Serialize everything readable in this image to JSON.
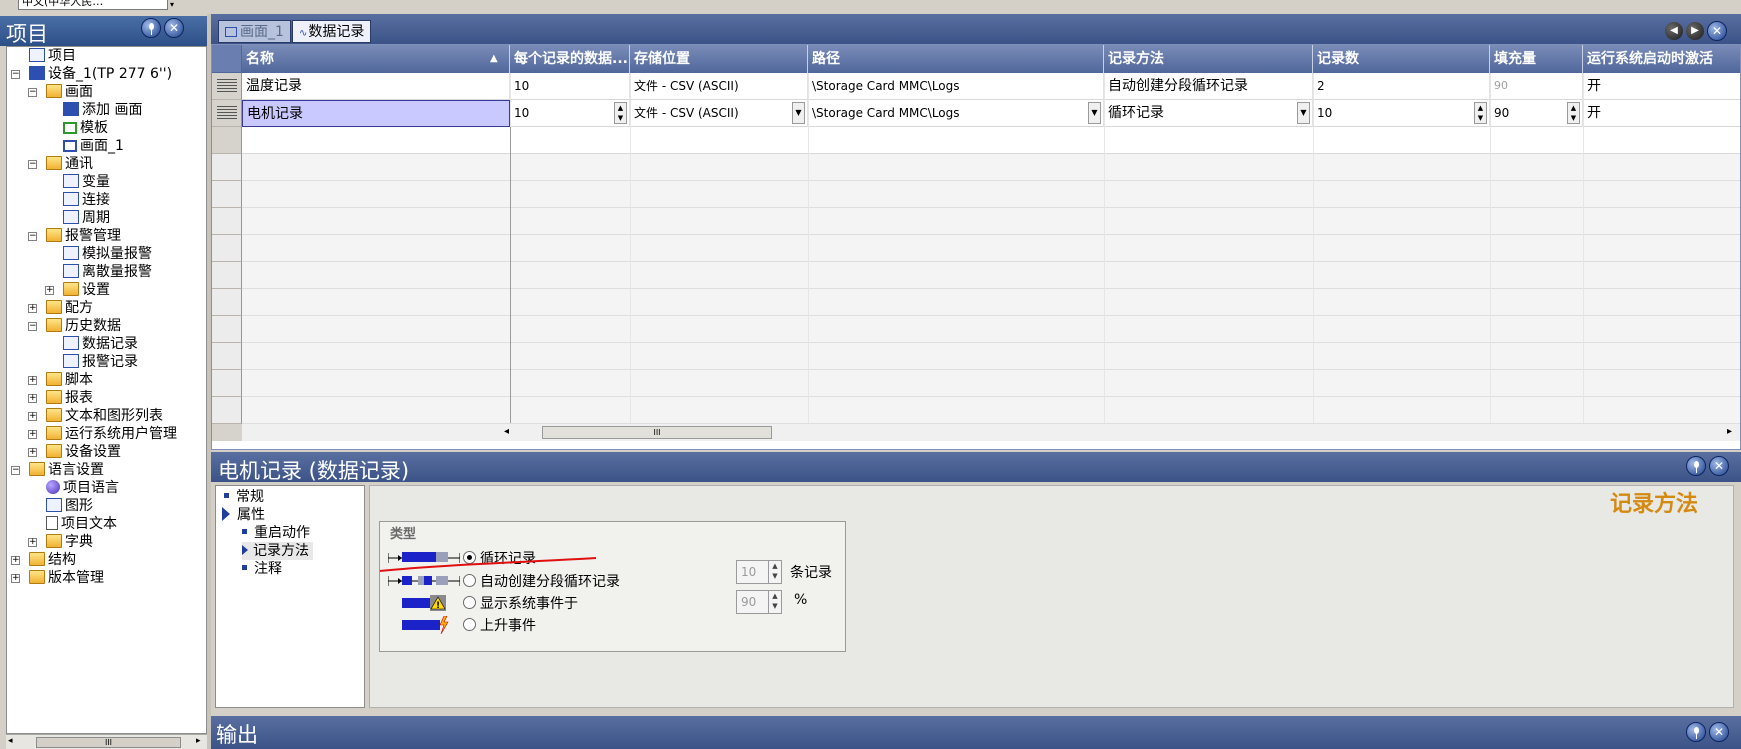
{
  "top": {
    "language_value": "中文(中华人民…",
    "dropdown_glyph": "▾"
  },
  "project": {
    "title": "项目",
    "tree": [
      {
        "label": "项目",
        "level": 0,
        "icon": "project-icon",
        "expander": ""
      },
      {
        "label": "设备_1(TP 277 6'')",
        "level": 0,
        "icon": "device-icon",
        "expander": "−"
      },
      {
        "label": "画面",
        "level": 1,
        "icon": "folder-icon",
        "expander": "−"
      },
      {
        "label": "添加 画面",
        "level": 2,
        "icon": "add-screen-icon",
        "expander": ""
      },
      {
        "label": "模板",
        "level": 2,
        "icon": "template-icon",
        "expander": ""
      },
      {
        "label": "画面_1",
        "level": 2,
        "icon": "screen-icon",
        "expander": ""
      },
      {
        "label": "通讯",
        "level": 1,
        "icon": "folder-icon",
        "expander": "−"
      },
      {
        "label": "变量",
        "level": 2,
        "icon": "tag-icon",
        "expander": ""
      },
      {
        "label": "连接",
        "level": 2,
        "icon": "connection-icon",
        "expander": ""
      },
      {
        "label": "周期",
        "level": 2,
        "icon": "cycle-icon",
        "expander": ""
      },
      {
        "label": "报警管理",
        "level": 1,
        "icon": "folder-icon",
        "expander": "−"
      },
      {
        "label": "模拟量报警",
        "level": 2,
        "icon": "analog-alarm-icon",
        "expander": ""
      },
      {
        "label": "离散量报警",
        "level": 2,
        "icon": "discrete-alarm-icon",
        "expander": ""
      },
      {
        "label": "设置",
        "level": 2,
        "icon": "folder-icon",
        "expander": "+"
      },
      {
        "label": "配方",
        "level": 1,
        "icon": "folder-icon",
        "expander": "+"
      },
      {
        "label": "历史数据",
        "level": 1,
        "icon": "folder-icon",
        "expander": "−"
      },
      {
        "label": "数据记录",
        "level": 2,
        "icon": "data-log-icon",
        "expander": ""
      },
      {
        "label": "报警记录",
        "level": 2,
        "icon": "alarm-log-icon",
        "expander": ""
      },
      {
        "label": "脚本",
        "level": 1,
        "icon": "folder-icon",
        "expander": "+"
      },
      {
        "label": "报表",
        "level": 1,
        "icon": "folder-icon",
        "expander": "+"
      },
      {
        "label": "文本和图形列表",
        "level": 1,
        "icon": "folder-icon",
        "expander": "+"
      },
      {
        "label": "运行系统用户管理",
        "level": 1,
        "icon": "folder-icon",
        "expander": "+"
      },
      {
        "label": "设备设置",
        "level": 1,
        "icon": "folder-icon",
        "expander": "+"
      },
      {
        "label": "语言设置",
        "level": 0,
        "icon": "folder-icon",
        "expander": "−"
      },
      {
        "label": "项目语言",
        "level": 1,
        "icon": "globe-icon",
        "expander": ""
      },
      {
        "label": "图形",
        "level": 1,
        "icon": "graphics-icon",
        "expander": ""
      },
      {
        "label": "项目文本",
        "level": 1,
        "icon": "text-icon",
        "expander": ""
      },
      {
        "label": "字典",
        "level": 1,
        "icon": "folder-icon",
        "expander": "+"
      },
      {
        "label": "结构",
        "level": 0,
        "icon": "folder-icon",
        "expander": "+"
      },
      {
        "label": "版本管理",
        "level": 0,
        "icon": "folder-icon",
        "expander": "+"
      }
    ],
    "scroll_thumb": "III"
  },
  "tabs": [
    {
      "label": "画面_1",
      "active": false
    },
    {
      "label": "数据记录",
      "active": true
    }
  ],
  "nav_buttons": {
    "prev": "◀",
    "next": "▶",
    "close": "✕"
  },
  "table": {
    "columns": [
      "名称",
      "每个记录的数据...",
      "存储位置",
      "路径",
      "记录方法",
      "记录数",
      "填充量",
      "运行系统启动时激活"
    ],
    "rows": [
      {
        "name": "温度记录",
        "per_record": "10",
        "storage": "文件 - CSV (ASCII)",
        "path": "\\Storage Card MMC\\Logs",
        "method": "自动创建分段循环记录",
        "count": "2",
        "fill": "90",
        "activate": "开"
      },
      {
        "name": "电机记录",
        "per_record": "10",
        "storage": "文件 - CSV (ASCII)",
        "path": "\\Storage Card MMC\\Logs",
        "method": "循环记录",
        "count": "10",
        "fill": "90",
        "activate": "开"
      }
    ],
    "scroll_thumb": "III",
    "scroll_left": "◂",
    "scroll_right": "▸"
  },
  "properties": {
    "title": "电机记录 (数据记录)",
    "section_title": "记录方法",
    "nav": [
      {
        "label": "常规",
        "level": 0,
        "marker": "bullet"
      },
      {
        "label": "属性",
        "level": 0,
        "marker": "arrow"
      },
      {
        "label": "重启动作",
        "level": 1,
        "marker": "bullet"
      },
      {
        "label": "记录方法",
        "level": 1,
        "marker": "arrow",
        "selected": true
      },
      {
        "label": "注释",
        "level": 1,
        "marker": "bullet"
      }
    ],
    "group_label": "类型",
    "options": [
      {
        "label": "循环记录",
        "checked": true
      },
      {
        "label": "自动创建分段循环记录",
        "checked": false
      },
      {
        "label": "显示系统事件于",
        "checked": false
      },
      {
        "label": "上升事件",
        "checked": false
      }
    ],
    "segment_count": "10",
    "segment_unit": "条记录",
    "event_percent": "90",
    "event_unit": "%"
  },
  "output": {
    "title": "输出"
  },
  "colors": {
    "accent_orange": "#d48a10",
    "header_blue": "#3b5388",
    "annotation_red": "#e01010"
  }
}
